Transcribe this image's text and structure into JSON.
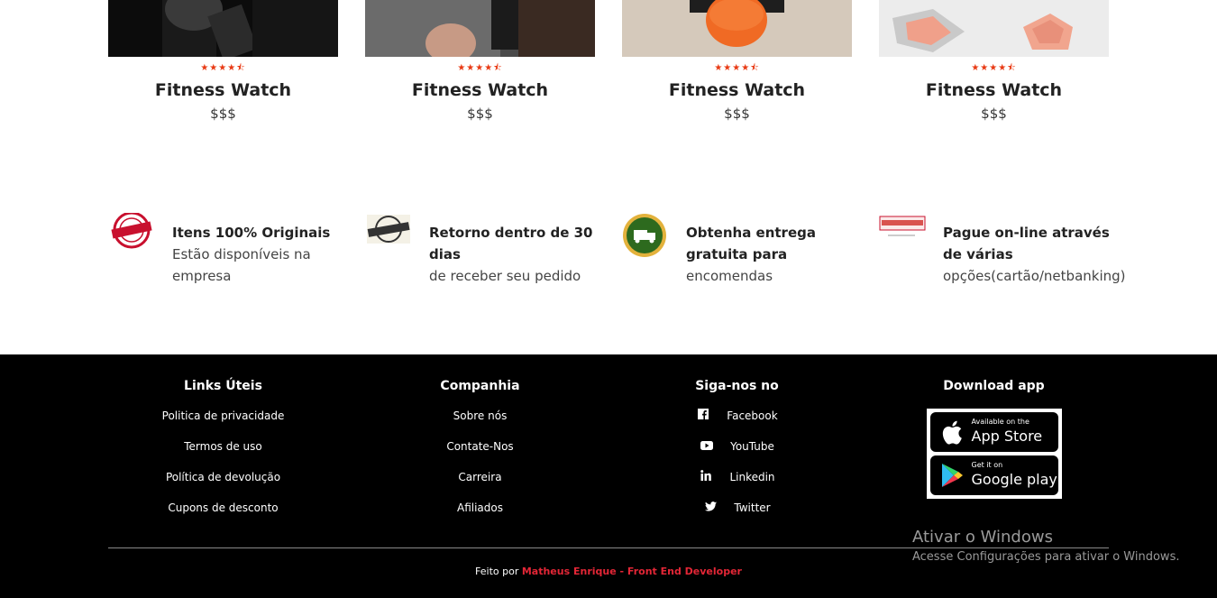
{
  "products": [
    {
      "rating_stars": "★★★★⯪",
      "name": "Fitness Watch",
      "price": "$$$"
    },
    {
      "rating_stars": "★★★★⯪",
      "name": "Fitness Watch",
      "price": "$$$"
    },
    {
      "rating_stars": "★★★★⯪",
      "name": "Fitness Watch",
      "price": "$$$"
    },
    {
      "rating_stars": "★★★★⯪",
      "name": "Fitness Watch",
      "price": "$$$"
    }
  ],
  "features": [
    {
      "icon": "certified-stamp-icon",
      "title": "Itens 100% Originais",
      "desc": "Estão disponíveis na empresa"
    },
    {
      "icon": "return-stamp-icon",
      "title": "Retorno dentro de 30 dias",
      "desc": "de receber seu pedido"
    },
    {
      "icon": "delivery-truck-icon",
      "title": "Obtenha entrega gratuita para",
      "desc": "encomendas"
    },
    {
      "icon": "online-payment-icon",
      "title": "Pague on-line através de várias",
      "desc": "opções(cartão/netbanking)"
    }
  ],
  "footer": {
    "useful_links": {
      "title": "Links Úteis",
      "items": [
        "Politica de privacidade",
        "Termos de uso",
        "Política de devolução",
        "Cupons de desconto"
      ]
    },
    "company": {
      "title": "Companhia",
      "items": [
        "Sobre nós",
        "Contate-Nos",
        "Carreira",
        "Afiliados"
      ]
    },
    "social": {
      "title": "Siga-nos no",
      "items": [
        {
          "icon": "facebook-icon",
          "label": "Facebook"
        },
        {
          "icon": "youtube-icon",
          "label": "YouTube"
        },
        {
          "icon": "linkedin-icon",
          "label": "Linkedin"
        },
        {
          "icon": "twitter-icon",
          "label": "Twitter"
        }
      ]
    },
    "download": {
      "title": "Download app",
      "app_store_small": "Available on the",
      "app_store_big": "App Store",
      "google_small": "Get it on",
      "google_big": "Google play"
    },
    "credit_prefix": "Feito por",
    "credit_author": "Matheus Enrique - Front End Developer"
  },
  "watermark": {
    "line1": "Ativar o Windows",
    "line2": "Acesse Configurações para ativar o Windows."
  },
  "colors": {
    "accent_red": "#e32636",
    "star": "#e83a14",
    "footer_bg": "#000000"
  }
}
